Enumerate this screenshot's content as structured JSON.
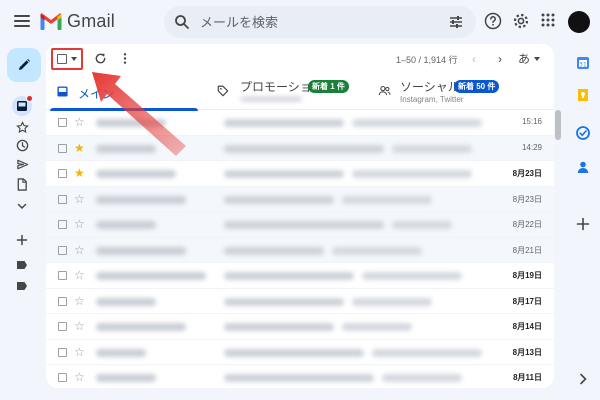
{
  "app": {
    "name": "Gmail"
  },
  "search": {
    "placeholder": "メールを検索"
  },
  "toolbar": {
    "pagination": "1–50 / 1,914 行",
    "prev": "‹",
    "next": "›",
    "input_lang": "あ"
  },
  "tabs": [
    {
      "label": "メイン"
    },
    {
      "label": "プロモーション",
      "badge": "新着 1 件"
    },
    {
      "label": "ソーシャル",
      "badge": "新着 50 件",
      "subtitle": "Instagram, Twitter"
    }
  ],
  "rows": [
    {
      "starred": false,
      "date": "15:16",
      "bold": false,
      "read": false
    },
    {
      "starred": true,
      "date": "14:29",
      "bold": false,
      "read": true
    },
    {
      "starred": true,
      "date": "8月23日",
      "bold": true,
      "read": false
    },
    {
      "starred": false,
      "date": "8月23日",
      "bold": false,
      "read": true
    },
    {
      "starred": false,
      "date": "8月22日",
      "bold": false,
      "read": true
    },
    {
      "starred": false,
      "date": "8月21日",
      "bold": false,
      "read": true
    },
    {
      "starred": false,
      "date": "8月19日",
      "bold": true,
      "read": false
    },
    {
      "starred": false,
      "date": "8月17日",
      "bold": true,
      "read": false
    },
    {
      "starred": false,
      "date": "8月14日",
      "bold": true,
      "read": false
    },
    {
      "starred": false,
      "date": "8月13日",
      "bold": true,
      "read": false
    },
    {
      "starred": false,
      "date": "8月11日",
      "bold": true,
      "read": false
    }
  ],
  "colors": {
    "accent": "#0b57d0",
    "compose_bg": "#c2e7ff",
    "promo_badge": "#188038",
    "social_badge": "#0b57d0",
    "highlight_red": "#e53935",
    "star": "#f4b400"
  }
}
